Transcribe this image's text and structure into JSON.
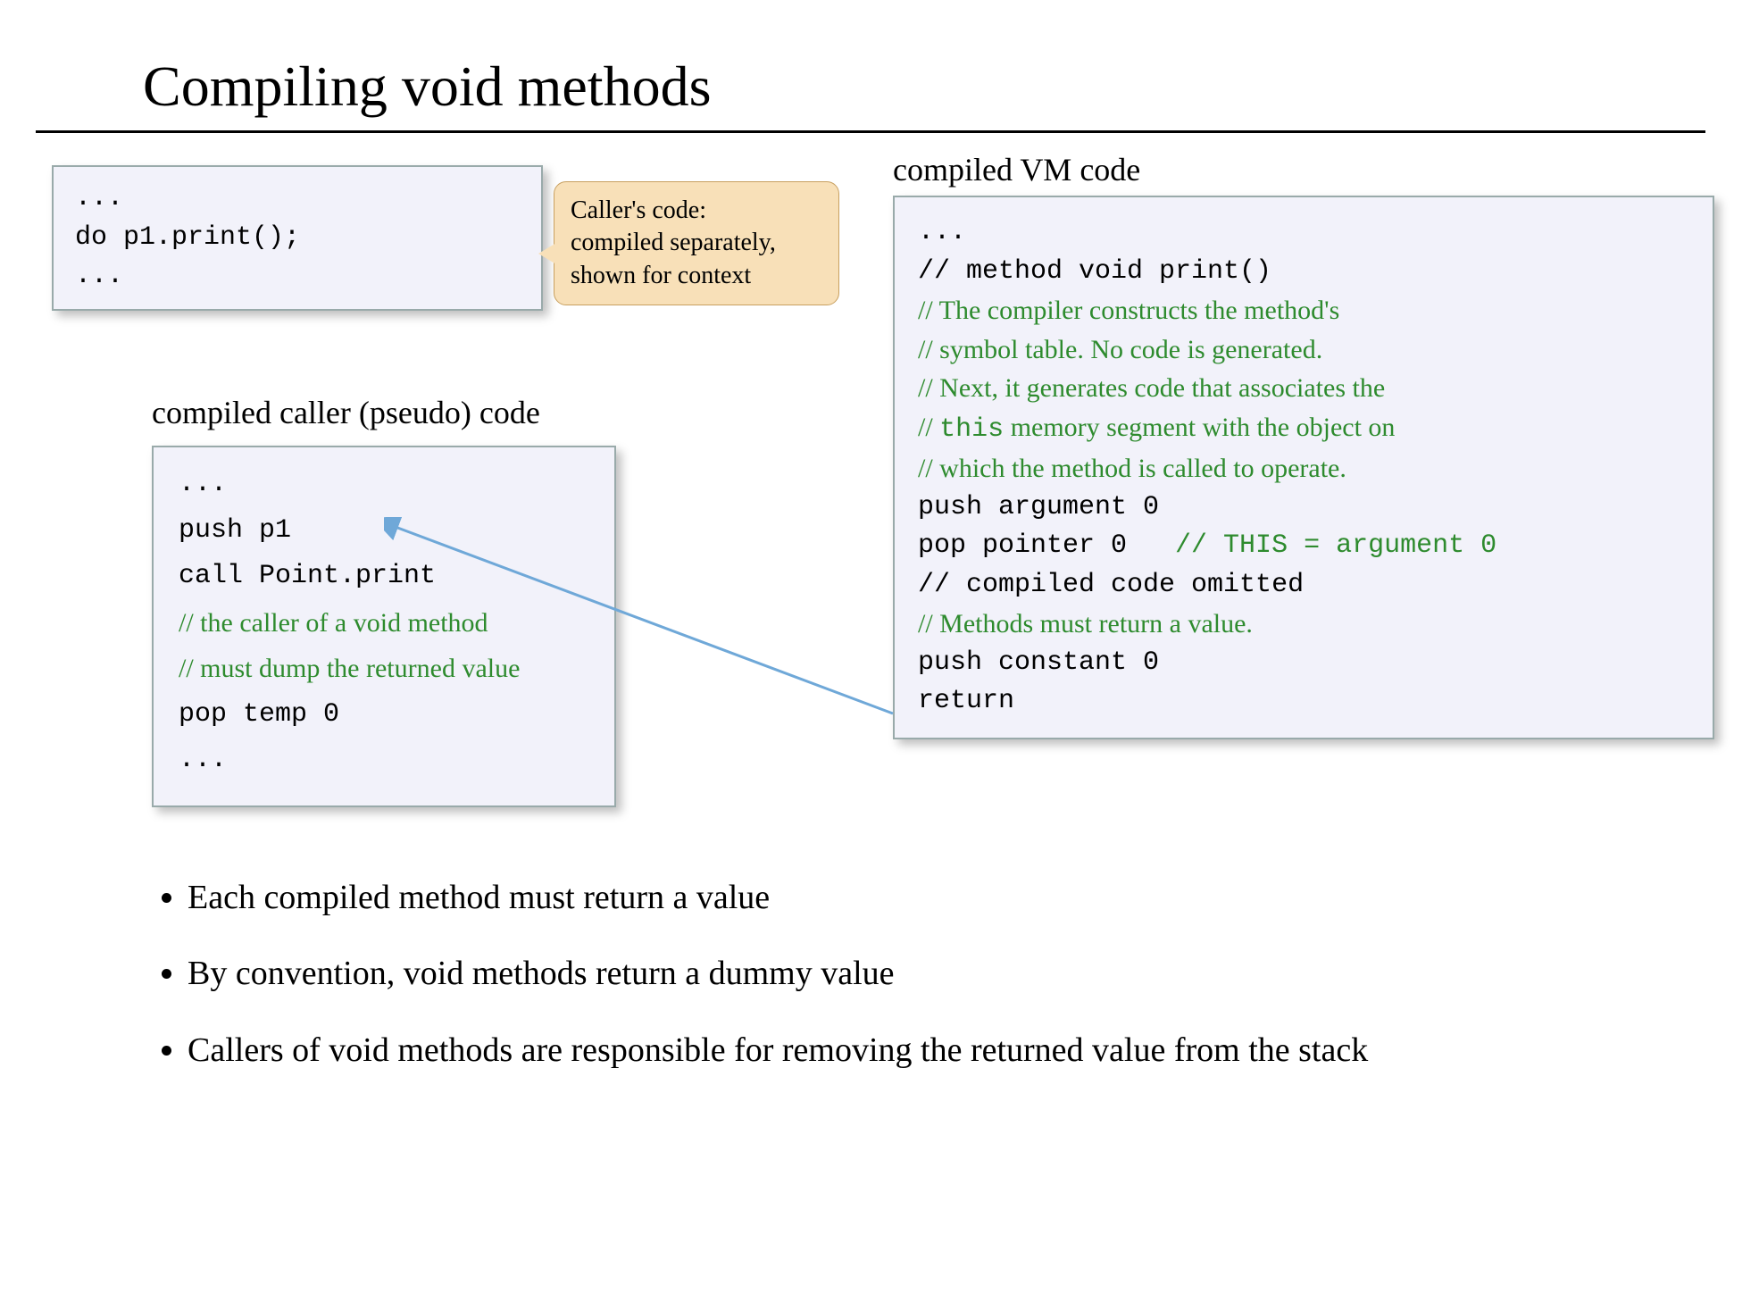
{
  "title": "Compiling void methods",
  "caller_source": {
    "pre": "...",
    "stmt": "do p1.print();",
    "post": "..."
  },
  "callout": {
    "line1": "Caller's code:",
    "line2": "compiled separately,",
    "line3": "shown for context"
  },
  "labels": {
    "pseudo": "compiled caller (pseudo) code",
    "vm": "compiled VM code"
  },
  "pseudo": {
    "l0": "...",
    "l1": "push p1",
    "l2": "call Point.print",
    "c1": "// the caller of a void method",
    "c2": "// must dump the returned value",
    "l3": "pop temp 0",
    "l4": "..."
  },
  "vm": {
    "l0": "...",
    "l1": "// method void print()",
    "c1": "// The compiler constructs the method's",
    "c2": "// symbol table. No code is generated.",
    "c3": "// Next, it generates code that associates the",
    "c4a": "// ",
    "c4b": "this",
    "c4c": " memory segment with the object on",
    "c5": "// which the method is called to operate.",
    "l2": "push argument 0",
    "l3a": "pop pointer 0   ",
    "l3b": "// THIS = argument 0",
    "l4": "// compiled code omitted",
    "c6": "// Methods must return a value.",
    "l5": "push constant 0",
    "l6": "return"
  },
  "bullets": {
    "b1": "Each compiled method must return a value",
    "b2": "By convention, void methods return a dummy value",
    "b3": "Callers of void methods are responsible for removing the returned value from the stack"
  }
}
